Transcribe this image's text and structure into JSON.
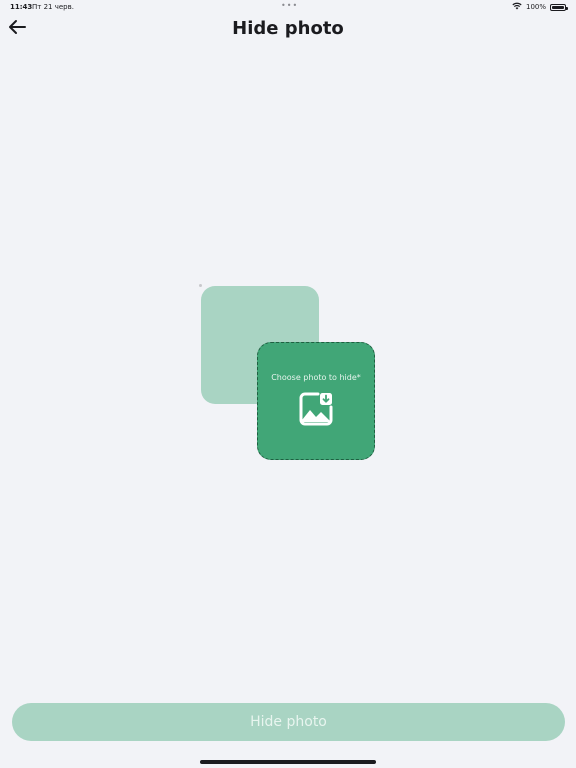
{
  "status_bar": {
    "time": "11:43",
    "date": "Пт 21 черв.",
    "dots": "•••",
    "battery_text": "100%",
    "icons": [
      "wifi-icon",
      "battery-icon"
    ]
  },
  "header": {
    "title": "Hide photo",
    "back_icon": "arrow-left-icon"
  },
  "picker": {
    "label": "Choose photo to hide*",
    "icon": "image-download-icon"
  },
  "footer": {
    "button_label": "Hide photo"
  },
  "colors": {
    "background": "#f2f3f7",
    "accent": "#41a677",
    "accent_light": "#a9d4c3",
    "dashed_border": "#1f5f41"
  }
}
